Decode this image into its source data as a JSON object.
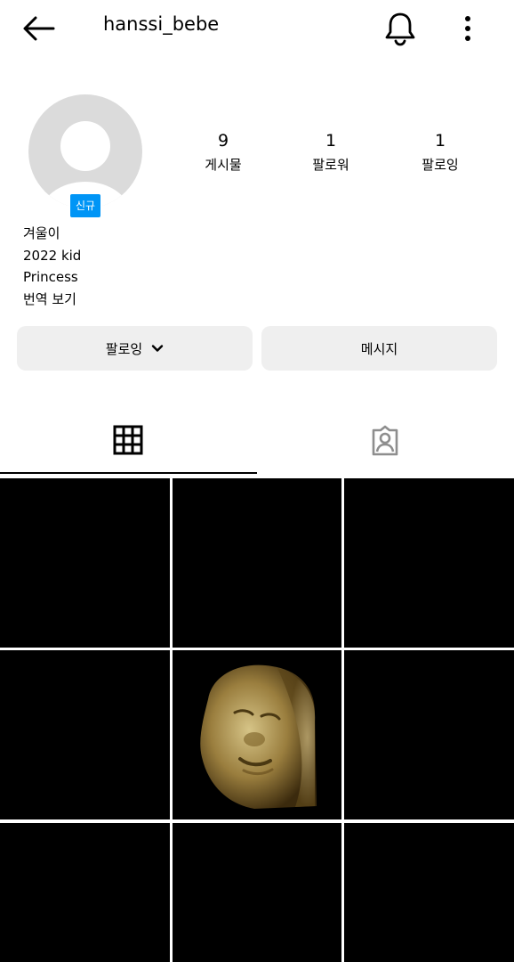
{
  "header": {
    "username": "hanssi_bebe",
    "back_icon": "arrow-left-icon",
    "bell_icon": "bell-icon",
    "more_icon": "more-vertical-icon"
  },
  "profile": {
    "avatar_icon": "default-avatar-icon",
    "new_badge": "신규",
    "stats": [
      {
        "value": "9",
        "label": "게시물"
      },
      {
        "value": "1",
        "label": "팔로워"
      },
      {
        "value": "1",
        "label": "팔로잉"
      }
    ],
    "bio": {
      "name": "겨울이",
      "line1": "2022 kid",
      "line2": "Princess",
      "translate": "번역 보기"
    }
  },
  "actions": {
    "following_label": "팔로잉",
    "message_label": "메시지"
  },
  "tabs": {
    "grid_icon": "grid-icon",
    "tagged_icon": "tagged-person-icon",
    "active": "grid"
  },
  "posts": {
    "count": 9,
    "thumbnail_icon": "ultrasound-photo-icon",
    "colors": {
      "background": "#000000",
      "accent": "#0095f6"
    }
  }
}
